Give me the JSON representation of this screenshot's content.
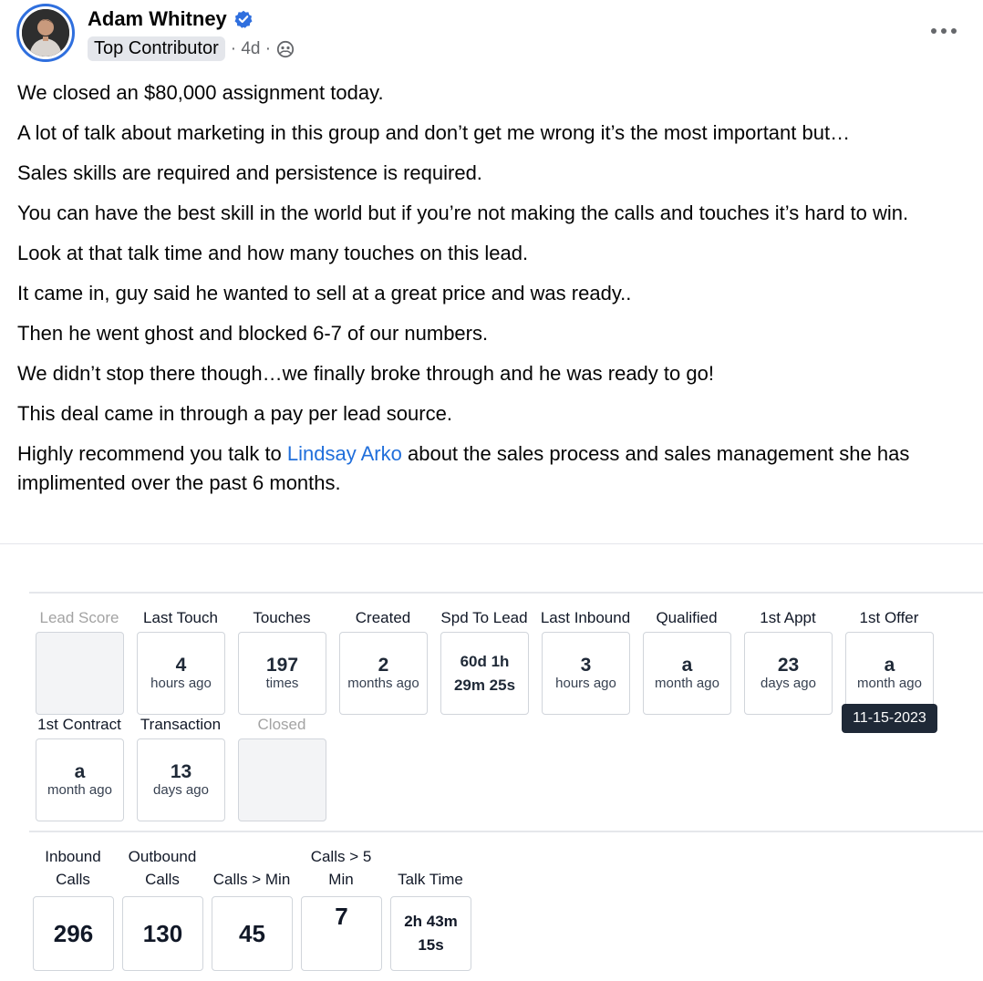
{
  "post": {
    "author": "Adam Whitney",
    "badge": "Top Contributor",
    "time": "· 4d ·",
    "paragraphs": [
      "We closed an $80,000 assignment today.",
      "A lot of talk about marketing in this group and don’t get me wrong it’s the most important but…",
      "Sales skills are required and persistence is required.",
      "You can have the best skill in the world but if you’re not making the calls and touches it’s hard to win.",
      "Look at that talk time and how many touches on this lead.",
      "It came in, guy said he wanted to sell at a great price and was ready..",
      "Then he went ghost and blocked 6-7 of our numbers.",
      "We didn’t stop there though…we finally broke through and he was ready to go!",
      "This deal came in through a pay per lead source."
    ],
    "last_paragraph": {
      "before": "Highly recommend you talk to ",
      "mention": "Lindsay Arko",
      "after": " about the sales process and sales management she has implimented over the past 6 months."
    }
  },
  "crm": {
    "stats": [
      {
        "label": "Lead Score",
        "value": "",
        "unit": ""
      },
      {
        "label": "Last Touch",
        "value": "4",
        "unit": "hours ago"
      },
      {
        "label": "Touches",
        "value": "197",
        "unit": "times"
      },
      {
        "label": "Created",
        "value": "2",
        "unit": "months ago"
      },
      {
        "label": "Spd To Lead",
        "line1": "60d 1h",
        "line2": "29m 25s"
      },
      {
        "label": "Last Inbound",
        "value": "3",
        "unit": "hours ago"
      },
      {
        "label": "Qualified",
        "value": "a",
        "unit": "month ago"
      },
      {
        "label": "1st Appt",
        "value": "23",
        "unit": "days ago"
      },
      {
        "label": "1st Offer",
        "value": "a",
        "unit": "month ago"
      },
      {
        "label": "1st Contract",
        "value": "a",
        "unit": "month ago"
      },
      {
        "label": "Transaction",
        "value": "13",
        "unit": "days ago"
      },
      {
        "label": "Closed",
        "value": "",
        "unit": ""
      }
    ],
    "tooltip": "11-15-2023",
    "calls": [
      {
        "label_1": "Inbound",
        "label_2": "Calls",
        "value": "296"
      },
      {
        "label_1": "Outbound",
        "label_2": "Calls",
        "value": "130"
      },
      {
        "label_1": "",
        "label_2": "Calls > Min",
        "value": "45"
      },
      {
        "label_1": "Calls > 5",
        "label_2": "Min",
        "value": "7"
      },
      {
        "label_1": "",
        "label_2": "Talk Time",
        "line1": "2h 43m",
        "line2": "15s"
      }
    ]
  },
  "colors": {
    "link": "#216fdb",
    "verified": "#2f6fde",
    "tooltip_bg": "#1f2937"
  }
}
